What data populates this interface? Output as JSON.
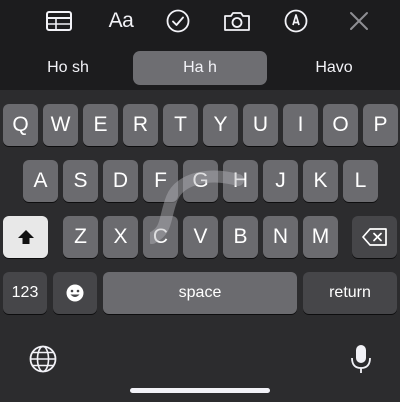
{
  "toolbar": {
    "text_format_label": "Aa",
    "icons": [
      "table-icon",
      "text-format-icon",
      "checklist-icon",
      "camera-icon",
      "markup-pen-icon",
      "close-icon"
    ]
  },
  "suggestions": [
    "Ho sh",
    "Ha h",
    "Havo"
  ],
  "keyboard": {
    "row1": [
      "Q",
      "W",
      "E",
      "R",
      "T",
      "Y",
      "U",
      "I",
      "O",
      "P"
    ],
    "row2": [
      "A",
      "S",
      "D",
      "F",
      "G",
      "H",
      "J",
      "K",
      "L"
    ],
    "row3": [
      "Z",
      "X",
      "C",
      "V",
      "B",
      "N",
      "M"
    ],
    "numbers_label": "123",
    "space_label": "space",
    "return_label": "return",
    "icons": [
      "shift-icon",
      "backspace-icon",
      "emoji-icon",
      "globe-icon",
      "microphone-icon"
    ]
  },
  "colors": {
    "background": "#1c1c1e",
    "keyboard_bg": "#2c2c2e",
    "key": "#6b6b6f",
    "key_dark": "#464649",
    "suggestion_highlight": "#6e6e72"
  }
}
